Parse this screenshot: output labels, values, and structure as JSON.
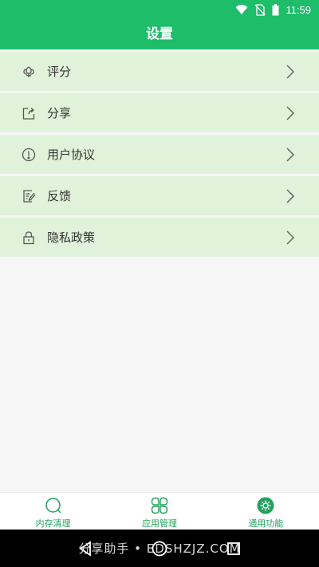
{
  "status_bar": {
    "time": "11:59",
    "icons": [
      "wifi-icon",
      "no-sim-icon",
      "battery-icon"
    ]
  },
  "app_bar": {
    "title": "设置"
  },
  "settings": {
    "items": [
      {
        "label": "评分",
        "icon": "flower-rating-icon"
      },
      {
        "label": "分享",
        "icon": "share-icon"
      },
      {
        "label": "用户协议",
        "icon": "info-circle-icon"
      },
      {
        "label": "反馈",
        "icon": "feedback-edit-icon"
      },
      {
        "label": "隐私政策",
        "icon": "lock-icon"
      }
    ]
  },
  "tab_bar": {
    "tabs": [
      {
        "label": "内存清理",
        "icon": "memory-clean-icon"
      },
      {
        "label": "应用管理",
        "icon": "app-manage-icon"
      },
      {
        "label": "通用功能",
        "icon": "general-gear-icon",
        "active": true
      }
    ]
  },
  "nav_bar": {
    "buttons": [
      "back-icon",
      "home-icon",
      "recents-icon"
    ]
  },
  "watermark": {
    "text": "分享助手 • EDSHZJZ.COM"
  },
  "colors": {
    "primary": "#1dbd6a",
    "row_background": "#e0f3da",
    "accent": "#22a35c",
    "page_background": "#f6f6f6"
  }
}
